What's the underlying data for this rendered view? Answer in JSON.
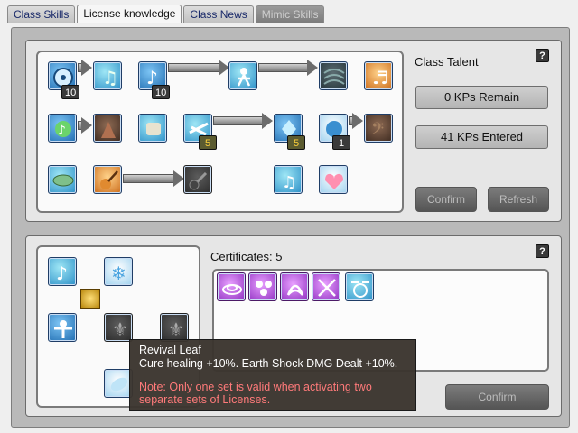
{
  "tabs": [
    {
      "label": "Class Skills",
      "state": "normal"
    },
    {
      "label": "License knowledge",
      "state": "active"
    },
    {
      "label": "Class News",
      "state": "normal"
    },
    {
      "label": "Mimic Skills",
      "state": "disabled"
    }
  ],
  "talent": {
    "title": "Class Talent",
    "help": "?",
    "remain": "0 KPs Remain",
    "entered": "41 KPs Entered",
    "confirm_label": "Confirm",
    "refresh_label": "Refresh",
    "badges": [
      "10",
      "10",
      "5",
      "5",
      "1"
    ]
  },
  "licenses": {
    "certificates_label": "Certificates: 5",
    "help": "?",
    "confirm_label": "Confirm"
  },
  "tooltip": {
    "title": "Revival Leaf",
    "effect": "Cure healing +10%. Earth Shock DMG Dealt +10%.",
    "note": "Note: Only one set is valid when activating two separate sets of Licenses."
  }
}
